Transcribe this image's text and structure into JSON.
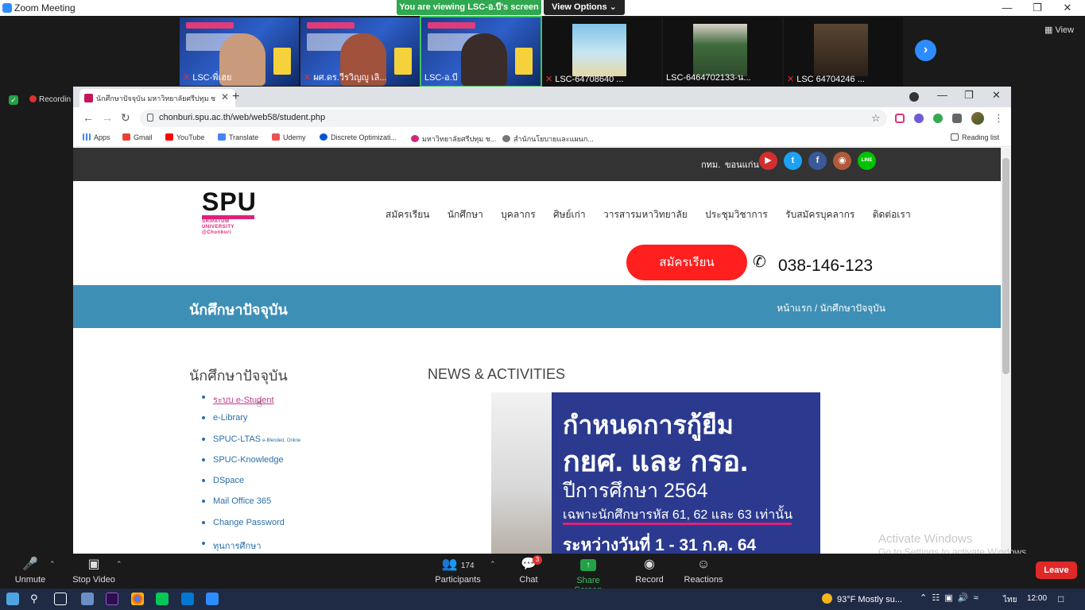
{
  "zoom": {
    "window_title": "Zoom Meeting",
    "viewing_banner": "You are viewing LSC-อ.บี's screen",
    "view_options": "View Options ⌄",
    "view_toggle": "View",
    "recording_label": "Recordin",
    "participants_tiles": [
      {
        "name": "LSC-พี่เฮย"
      },
      {
        "name": "ผศ.ดร.วีรวิญญู เลิ..."
      },
      {
        "name": "LSC-อ.บี"
      },
      {
        "name": "LSC-64708640 ..."
      },
      {
        "name": "LSC-6464702133-น..."
      },
      {
        "name": "LSC 64704246 ..."
      }
    ],
    "controls": {
      "unmute": "Unmute",
      "stop_video": "Stop Video",
      "participants": "Participants",
      "participants_count": "174",
      "chat": "Chat",
      "chat_badge": "3",
      "share_screen": "Share Screen",
      "record": "Record",
      "reactions": "Reactions",
      "leave": "Leave"
    }
  },
  "browser": {
    "tab_title": "นักศึกษาปัจจุบัน มหาวิทยาลัยศรีปทุม ช",
    "url": "chonburi.spu.ac.th/web/web58/student.php",
    "bookmarks": [
      "Apps",
      "Gmail",
      "YouTube",
      "Translate",
      "Udemy",
      "Discrete Optimizati...",
      "มหาวิทยาลัยศรีปทุม ช...",
      "สำนักนโยบายและแผนก..."
    ],
    "reading_list": "Reading list"
  },
  "site": {
    "locations": [
      "กทม.",
      "ขอนแก่น"
    ],
    "social": [
      "YouTube",
      "Twitter",
      "Facebook",
      "Instagram",
      "LINE"
    ],
    "social_line_text": "LINE",
    "logo": {
      "main": "SPU",
      "sub1": "SRIPATUM",
      "sub2": "UNIVERSITY",
      "sub3": "@Chonburi"
    },
    "nav": [
      "สมัครเรียน",
      "นักศึกษา",
      "บุคลากร",
      "ศิษย์เก่า",
      "วารสารมหาวิทยาลัย",
      "ประชุมวิชาการ",
      "รับสมัครบุคลากร",
      "ติดต่อเรา"
    ],
    "apply_button": "สมัครเรียน",
    "phone": "038-146-123",
    "banner_title": "นักศึกษาปัจจุบัน",
    "breadcrumb": "หน้าแรก  /  นักศึกษาปัจจุบัน",
    "sidebar_title": "นักศึกษาปัจจุบัน",
    "sidebar_links": [
      "ระบบ e-Student",
      "e-Library",
      "SPUC-LTAS",
      "SPUC-Knowledge",
      "DSpace",
      "Mail Office 365",
      "Change Password",
      "ทุนการศึกษา"
    ],
    "ltas_note": "e-Blended, Online",
    "news_title": "NEWS & ACTIVITIES",
    "news_image": {
      "line1": "กำหนดการกู้ยืม",
      "line2": "กยศ. และ กรอ.",
      "line3": "ปีการศึกษา 2564",
      "line4": "เฉพาะนักศึกษารหัส 61, 62 และ 63 เท่านั้น",
      "line5": "ระหว่างวันที่ 1 - 31 ก.ค. 64"
    }
  },
  "windows": {
    "activate_title": "Activate Windows",
    "activate_sub": "Go to Settings to activate Windows.",
    "weather": "93°F  Mostly su...",
    "language": "ไทย",
    "time": "12:00"
  }
}
